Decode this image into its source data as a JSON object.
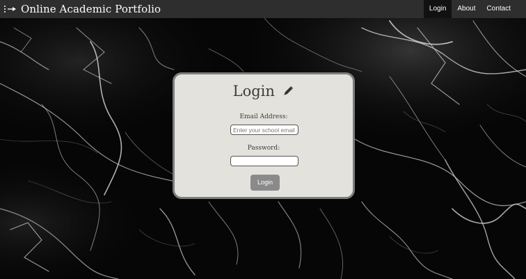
{
  "navbar": {
    "brand_icon": "dotted-arrow-icon",
    "title": "Online Academic Portfolio",
    "links": [
      {
        "label": "Login",
        "active": true
      },
      {
        "label": "About",
        "active": false
      },
      {
        "label": "Contact",
        "active": false
      }
    ]
  },
  "login_card": {
    "title": "Login",
    "title_icon": "pencil-icon",
    "email_label": "Email Address:",
    "email_placeholder": "Enter your school email",
    "email_value": "",
    "password_label": "Password:",
    "password_value": "",
    "submit_label": "Login"
  },
  "colors": {
    "navbar_bg": "#2e2e2e",
    "active_link_bg": "#111111",
    "card_bg": "#e4e2dd",
    "card_border": "#7e7e7e",
    "button_bg": "#8a8a8a",
    "background": "#050505"
  }
}
